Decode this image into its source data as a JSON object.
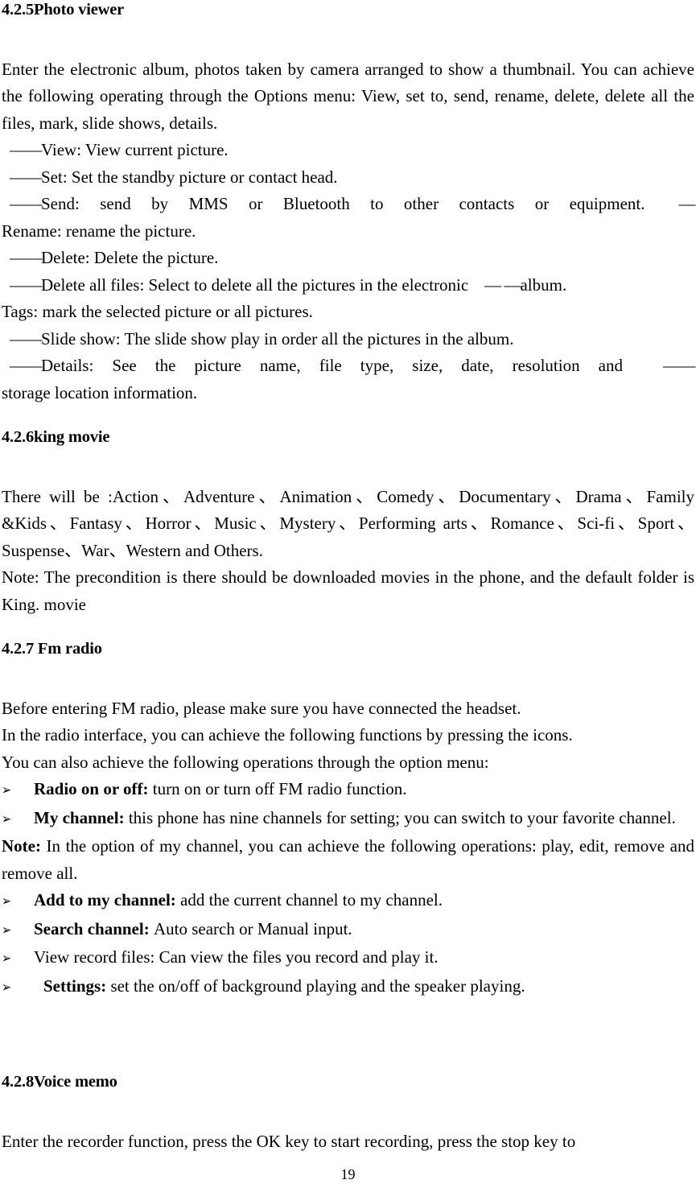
{
  "document": {
    "page_number": "19"
  },
  "sections": {
    "photo_viewer": {
      "heading": "4.2.5Photo viewer",
      "intro": "Enter the electronic album, photos taken by camera arranged to show a thumbnail. You can achieve the following operating through the Options menu: View, set to, send, rename, delete, delete all the files, mark, slide shows, details.",
      "items": [
        {
          "dash": "——",
          "text": "View: View current picture."
        },
        {
          "dash": "——",
          "text": "Set: Set the standby picture or contact head."
        },
        {
          "dash": "——",
          "text": "Send: send by MMS or Bluetooth to other contacts or equipment.",
          "trailing_dash": "—"
        },
        {
          "dash": "",
          "text": "Rename: rename the picture."
        },
        {
          "dash": "——",
          "text": "Delete: Delete the picture."
        },
        {
          "dash": "——",
          "text": "Delete all files: Select to delete all the pictures in the electronic",
          "trailing_dash": "— —",
          "trailing_text": "album."
        },
        {
          "dash": "",
          "text": "Tags: mark the selected picture or all pictures."
        },
        {
          "dash": "——",
          "text": "Slide show: The slide show play in order all the pictures in the album."
        },
        {
          "dash": "——",
          "text": "Details: See the picture name, file type, size, date, resolution and",
          "trailing_dash": "——"
        },
        {
          "dash": "",
          "text": "storage location information."
        }
      ]
    },
    "king_movie": {
      "heading": "4.2.6king movie",
      "genres_line": "  There will be :Action、Adventure、Animation、Comedy、Documentary、Drama、Family &Kids、Fantasy、Horror、Music、Mystery、Performing arts、Romance、Sci-fi、Sport、Suspense、War、Western and Others.",
      "note": "Note: The precondition is there should be downloaded movies in the phone, and the default folder is King. movie"
    },
    "fm_radio": {
      "heading": "4.2.7 Fm radio",
      "paragraphs": [
        "Before entering FM radio, please make sure you have connected the headset.",
        "In the radio interface, you can achieve the following functions by pressing the icons.",
        "You can also achieve the following operations through the option menu:"
      ],
      "bullets": [
        {
          "arrow": "➢",
          "label": "Radio on or off",
          "sep": ": ",
          "text": "turn on or turn off FM radio function."
        },
        {
          "arrow": "➢",
          "label": "My channel",
          "sep": ": ",
          "text": "this phone has nine channels for setting; you can switch to your favorite channel."
        }
      ],
      "note_label": "Note:",
      "note_text": " In the option of my channel, you can achieve the following operations: play, edit, remove and remove all.",
      "bullets2": [
        {
          "arrow": "➢",
          "label": "Add to my channel",
          "sep": ": ",
          "text": "add the current channel to my channel."
        },
        {
          "arrow": "➢",
          "label": "Search channel",
          "sep": ": ",
          "text": "Auto search or Manual input."
        },
        {
          "arrow": "➢",
          "label": "View record files:",
          "sep": " ",
          "text": "Can view the files you record and play it.",
          "label_bold": false
        },
        {
          "arrow": "➢",
          "label": "Settings",
          "sep": ": ",
          "text": "set the on/off of background playing and the speaker playing.",
          "extra_indent": true
        }
      ]
    },
    "voice_memo": {
      "heading": "4.2.8Voice memo",
      "paragraph": "Enter the recorder function, press the OK key to start recording, press the stop key to"
    }
  }
}
